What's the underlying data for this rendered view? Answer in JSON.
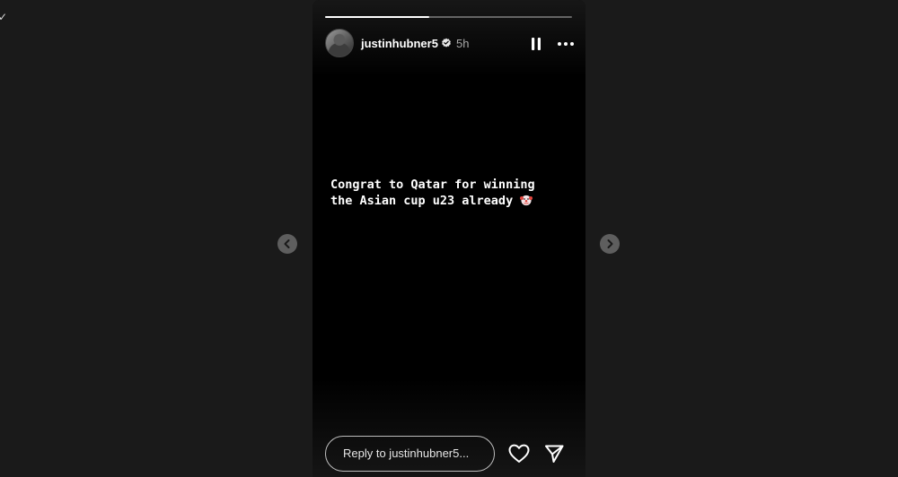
{
  "story": {
    "username": "justinhubner5",
    "time_ago": "5h",
    "progress": 0.42,
    "text_lines": [
      "Congrat to Qatar for winning",
      "the Asian cup u23 already "
    ],
    "emoji": "clown-face",
    "reply_placeholder": "Reply to justinhubner5..."
  },
  "icons": {
    "verified": "verified-badge-icon",
    "pause": "pause-icon",
    "more": "more-options-icon",
    "like": "heart-icon",
    "share": "send-icon",
    "prev": "chevron-left-icon",
    "next": "chevron-right-icon"
  },
  "colors": {
    "page_background": "#1a1a1a",
    "story_background": "#000000",
    "text": "#ffffff",
    "muted_text": "#a8a8a8"
  }
}
